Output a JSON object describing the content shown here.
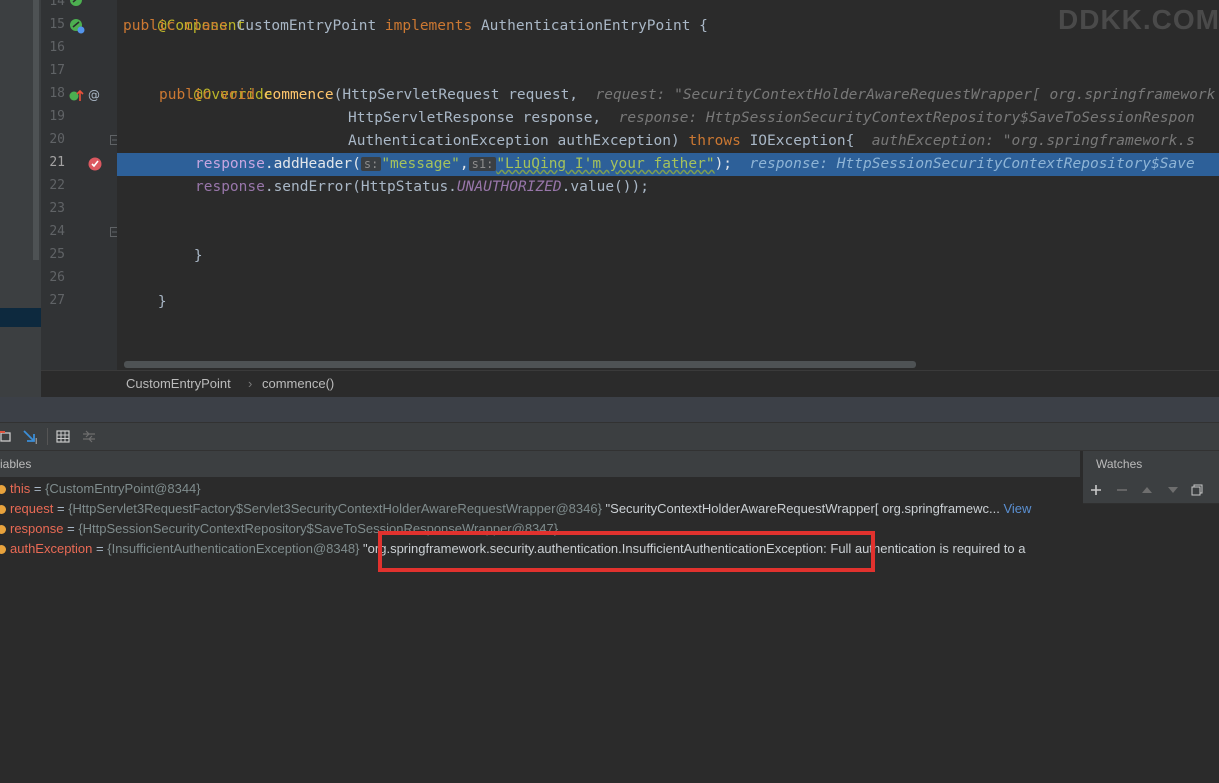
{
  "watermark": "DDKK.COM",
  "gutter": {
    "lines": [
      "14",
      "15",
      "16",
      "17",
      "18",
      "19",
      "20",
      "21",
      "22",
      "23",
      "24",
      "25",
      "26",
      "27"
    ]
  },
  "code": {
    "l14": "@Component",
    "l15": {
      "kw1": "public class ",
      "name": "CustomEntryPoint ",
      "kw2": "implements ",
      "iface": "AuthenticationEntryPoint {"
    },
    "l17": "@Override",
    "l18": {
      "kw": "public void ",
      "fn": "commence",
      "rest": "(HttpServletRequest request,  ",
      "inlay": "request: \"SecurityContextHolderAwareRequestWrapper[ org.springframework"
    },
    "l19": {
      "rest": "HttpServletResponse response,  ",
      "inlay": "response: HttpSessionSecurityContextRepository$SaveToSessionRespon"
    },
    "l20": {
      "rest": "AuthenticationException authException) ",
      "kw": "throws ",
      "rest2": "IOException{  ",
      "inlay": "authException: \"org.springframework.s"
    },
    "l21": {
      "var": "response",
      "call": ".addHeader(",
      "hint1": "s:",
      "str1": "\"message\"",
      "comma": ",",
      "hint2": "s1:",
      "str2": "\"LiuQing I'm your father\"",
      "end": ");  ",
      "inlay": "response: HttpSessionSecurityContextRepository$Save"
    },
    "l22": {
      "var": "response",
      "call": ".sendError(HttpStatus.",
      "const": "UNAUTHORIZED",
      "end": ".value());"
    },
    "l24": "}",
    "l26": "}"
  },
  "breadcrumb": {
    "class": "CustomEntryPoint",
    "sep": "›",
    "method": "commence()"
  },
  "variables": {
    "header": "iables",
    "rows": [
      {
        "name": "this",
        "eq": " = ",
        "type": "{CustomEntryPoint@8344}",
        "value": "",
        "link": ""
      },
      {
        "name": "request",
        "eq": " = ",
        "type": "{HttpServlet3RequestFactory$Servlet3SecurityContextHolderAwareRequestWrapper@8346}",
        "value": " \"SecurityContextHolderAwareRequestWrapper[ org.springframewc...",
        "link": " View"
      },
      {
        "name": "response",
        "eq": " = ",
        "type": "{HttpSessionSecurityContextRepository$SaveToSessionResponseWrapper@8347}",
        "value": "",
        "link": ""
      },
      {
        "name": "authException",
        "eq": " = ",
        "type": "{InsufficientAuthenticationException@8348}",
        "value": " \"org.springframework.security.authentication.InsufficientAuthenticationException: Full authentication is required to a",
        "link": ""
      }
    ]
  },
  "watches": {
    "title": "Watches"
  },
  "colors": {
    "highlight": "#2d6099",
    "annotation_box": "#e1322e",
    "bullet": "#e8a33d"
  }
}
